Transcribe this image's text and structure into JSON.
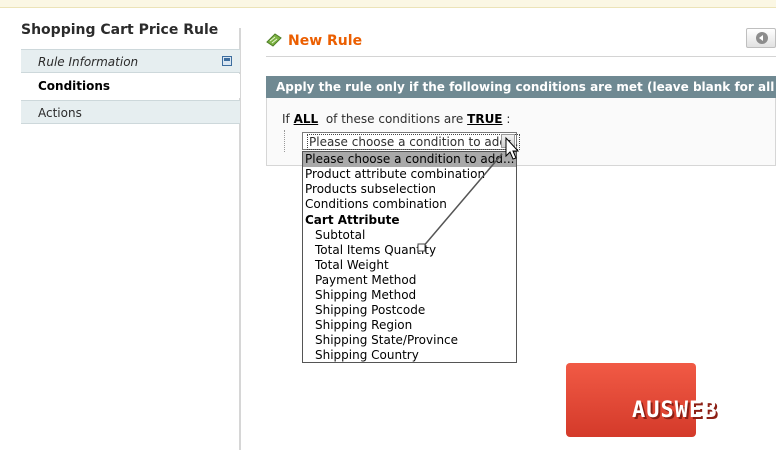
{
  "sidebar": {
    "title": "Shopping Cart Price Rule",
    "tabs": [
      {
        "label": "Rule Information"
      },
      {
        "label": "Conditions"
      },
      {
        "label": "Actions"
      }
    ]
  },
  "header": {
    "title": "New Rule"
  },
  "conditions": {
    "fieldset_title": "Apply the rule only if the following conditions are met (leave blank for all products)",
    "prefix": "If",
    "aggregator": "ALL",
    "middle": "of these conditions are",
    "value": "TRUE",
    "suffix": ":",
    "select_value": "Please choose a condition to add..."
  },
  "dropdown": {
    "options": [
      "Please choose a condition to add...",
      "Product attribute combination",
      "Products subselection",
      "Conditions combination",
      "Cart Attribute",
      "Subtotal",
      "Total Items Quantity",
      "Total Weight",
      "Payment Method",
      "Shipping Method",
      "Shipping Postcode",
      "Shipping Region",
      "Shipping State/Province",
      "Shipping Country"
    ]
  },
  "watermark": {
    "text": "AUSWEB"
  },
  "colors": {
    "accent": "#eb5e00",
    "fieldset_header": "#6f8992",
    "tab_bg": "#e6eef0",
    "logo_red": "#e04a36"
  }
}
